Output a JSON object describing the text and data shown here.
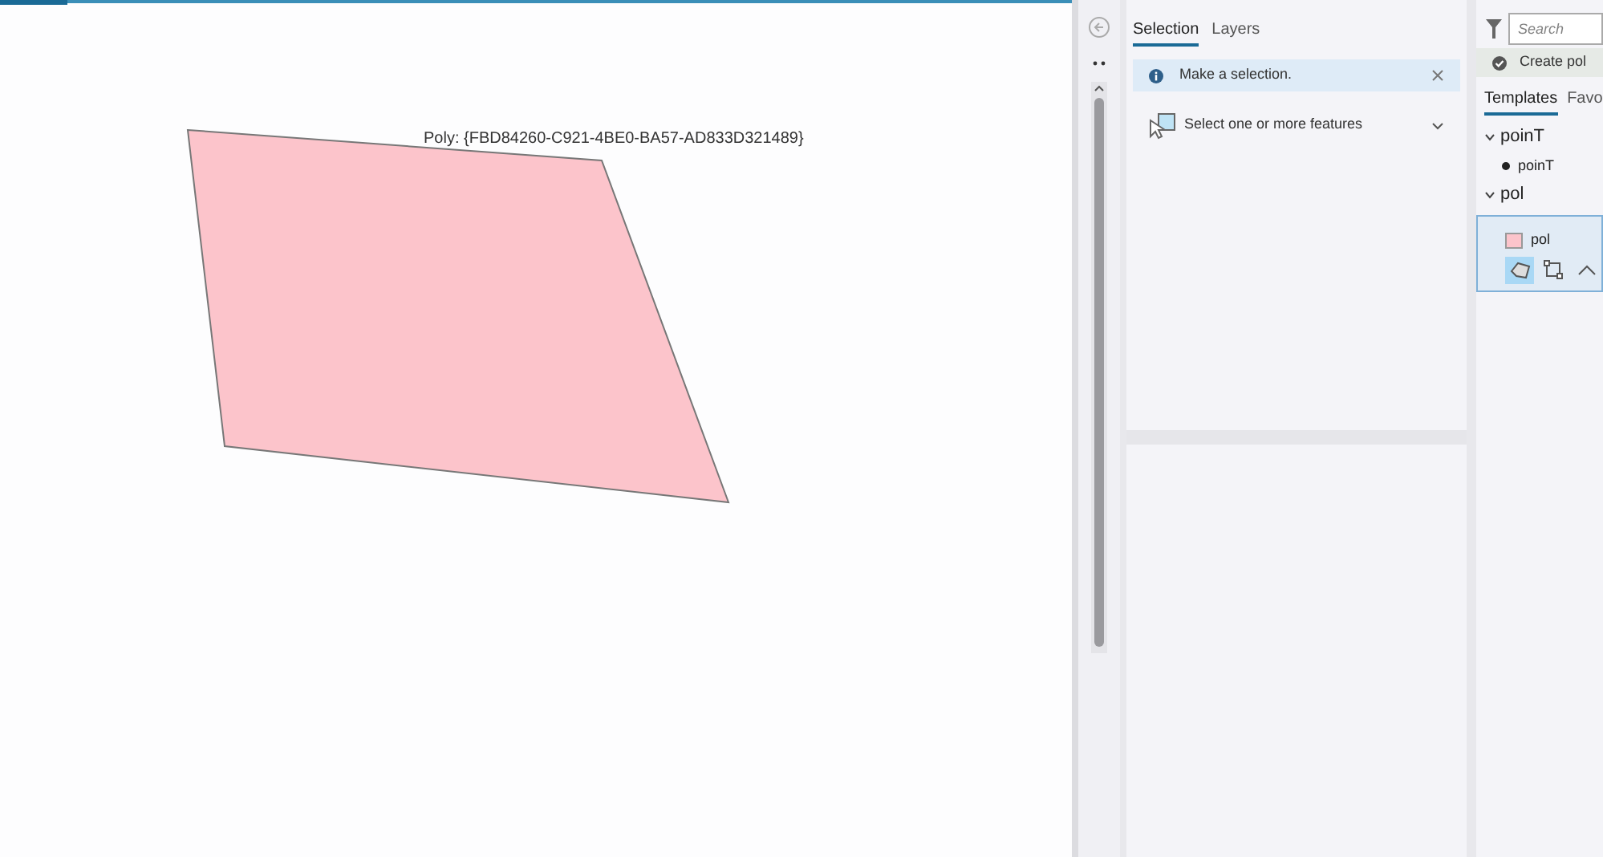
{
  "map": {
    "feature_label": "Poly: {FBD84260-C921-4BE0-BA57-AD833D321489}"
  },
  "attributes": {
    "tabs": [
      {
        "label": "Selection",
        "selected": true
      },
      {
        "label": "Layers",
        "selected": false
      }
    ],
    "message": "Make a selection.",
    "prompt": "Select one or more features"
  },
  "create_features": {
    "search": {
      "placeholder": "Search"
    },
    "status": "Create pol",
    "tabs": [
      {
        "label": "Templates",
        "selected": true
      },
      {
        "label": "Favo",
        "selected": false
      }
    ],
    "groups": [
      {
        "label": "poinT",
        "expanded": true,
        "children": [
          {
            "label": "poinT",
            "kind": "point",
            "selected": false
          }
        ]
      },
      {
        "label": "pol",
        "expanded": true,
        "children": [
          {
            "label": "pol",
            "kind": "polygon",
            "selected": true
          }
        ]
      }
    ],
    "tools": [
      {
        "kind": "polygon",
        "selected": true
      },
      {
        "kind": "rectangle",
        "selected": false
      },
      {
        "kind": "line",
        "selected": false
      }
    ]
  }
}
